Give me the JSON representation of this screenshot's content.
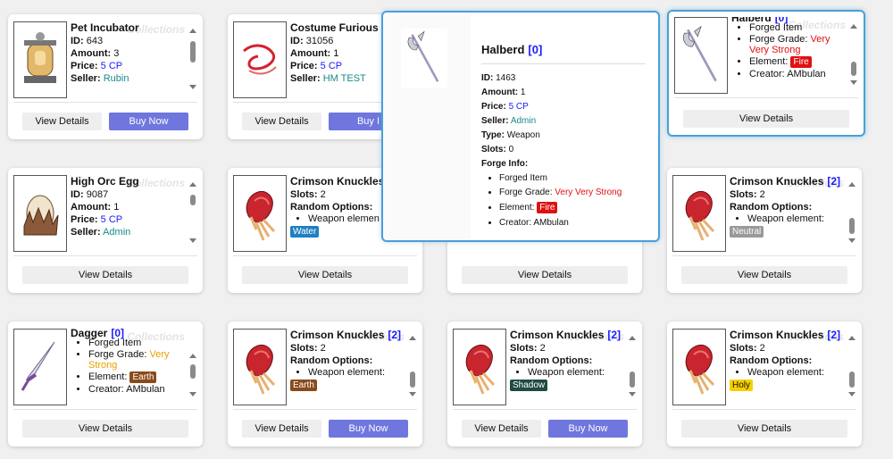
{
  "labels": {
    "view": "View Details",
    "buy": "Buy Now",
    "watermark": "Collections",
    "id": "ID:",
    "amount": "Amount:",
    "price": "Price:",
    "seller": "Seller:",
    "slots": "Slots:",
    "random": "Random Options:",
    "weapon_element": "Weapon element:",
    "type": "Type:",
    "forge_info": "Forge Info:",
    "forged": "Forged Item",
    "forge_grade": "Forge Grade:",
    "element": "Element:",
    "creator": "Creator:"
  },
  "cards": [
    {
      "name": "Pet Incubator",
      "id": "643",
      "amount": "3",
      "price": "5 CP",
      "seller": "Rubin"
    },
    {
      "name": "Costume Furious",
      "id": "31056",
      "amount": "1",
      "price": "5 CP",
      "seller": "HM TEST",
      "buy_partial": "Buy I"
    },
    {
      "name": "Halberd",
      "slot": "[0]",
      "grade": "Very Very Strong",
      "element": "Fire",
      "creator": "AMbulan"
    },
    {
      "name": "High Orc Egg",
      "id": "9087",
      "amount": "1",
      "price": "5 CP",
      "seller": "Admin"
    },
    {
      "name": "Crimson Knuckles",
      "slots": "2",
      "element": "Water",
      "truncated_element_label": "Weapon elemen"
    },
    {
      "name": "Crimson Knuckles",
      "slot": "[2]",
      "slots": "2",
      "element": "Neutral"
    },
    {
      "name": "Dagger",
      "slot": "[0]",
      "grade": "Very Strong",
      "element": "Earth",
      "creator": "AMbulan"
    },
    {
      "name": "Crimson Knuckles",
      "slot": "[2]",
      "slots": "2",
      "element": "Earth"
    },
    {
      "name": "Crimson Knuckles",
      "slot": "[2]",
      "slots": "2",
      "element": "Shadow"
    },
    {
      "name": "Crimson Knuckles",
      "slot": "[2]",
      "slots": "2",
      "element": "Holy"
    }
  ],
  "tooltip": {
    "name": "Halberd",
    "slot": "[0]",
    "id": "1463",
    "amount": "1",
    "price": "5 CP",
    "seller": "Admin",
    "type": "Weapon",
    "slots": "0",
    "forged": "Forged Item",
    "grade": "Very Very Strong",
    "element": "Fire",
    "creator": "AMbulan"
  },
  "colors": {
    "buy_button": "#6f76dd",
    "highlight_border": "#4a9fd8",
    "fire": "#e01010",
    "water": "#1f7fc2",
    "neutral": "#999999",
    "earth": "#8a4a1a",
    "shadow": "#1f4a45",
    "holy": "#f5d000"
  },
  "icons": {
    "pet_incubator": "incubator-icon",
    "costume": "red-ribbon-icon",
    "halberd": "halberd-icon",
    "egg": "egg-icon",
    "knuckles": "knuckle-icon",
    "dagger": "dagger-icon"
  }
}
